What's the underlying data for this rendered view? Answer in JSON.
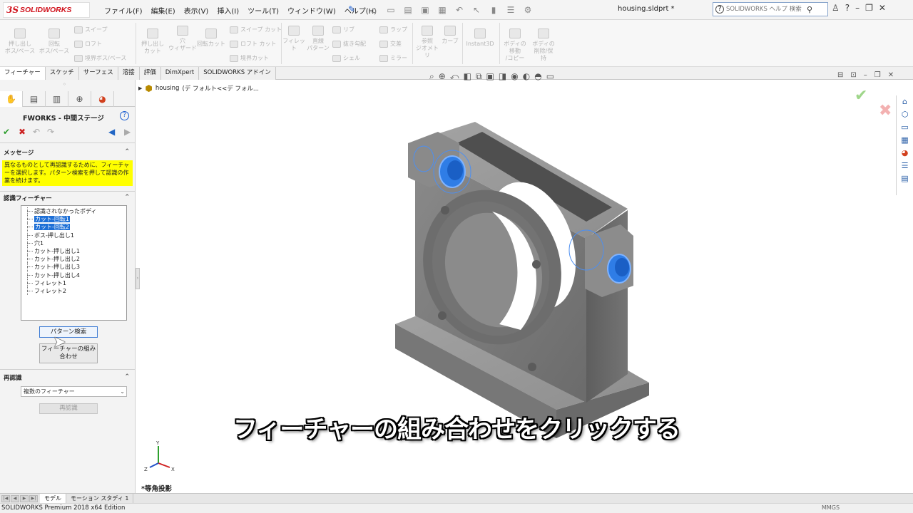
{
  "app": {
    "brand_mark": "3S",
    "brand_name": "SOLIDWORKS",
    "document_title": "housing.sldprt *",
    "help_search_placeholder": "SOLIDWORKS ヘルプ 検索"
  },
  "menu": [
    "ファイル(F)",
    "編集(E)",
    "表示(V)",
    "挿入(I)",
    "ツール(T)",
    "ウィンドウ(W)",
    "ヘルプ(H)"
  ],
  "command_manager": {
    "extrude_boss": "押し出し\nボス/ベース",
    "revolve_boss": "回転\nボス/ベース",
    "sweep": "スイープ",
    "loft": "ロフト",
    "boundary_boss": "境界ボス/ベース",
    "extrude_cut": "押し出し\nカット",
    "hole_wizard": "穴\nウィザード",
    "revolve_cut": "回転カット",
    "sweep_cut": "スイープ カット",
    "loft_cut": "ロフト カット",
    "boundary_cut": "境界カット",
    "fillet": "フィレット",
    "linear_pattern": "直線\nパターン",
    "rib": "リブ",
    "draft": "抜き勾配",
    "shell": "シェル",
    "wrap": "ラップ",
    "intersect": "交差",
    "mirror": "ミラー",
    "reference_geometry": "参照\nジオメトリ",
    "curves": "カーブ",
    "instant3d": "Instant3D",
    "move_copy_body": "ボディの\n移動\n/コピー",
    "delete_keep_body": "ボディの\n削除/保\n持"
  },
  "tabs": [
    "フィーチャー",
    "スケッチ",
    "サーフェス",
    "溶接",
    "評価",
    "DimXpert",
    "SOLIDWORKS アドイン"
  ],
  "property_manager": {
    "title": "FWORKS - 中間ステージ",
    "message_header": "メッセージ",
    "message_text": "異なるものとして再認識するために、フィーチャーを選択します。パターン検索を押して認識の作業を続けます。",
    "recognized_header": "認識フィーチャー",
    "features": [
      {
        "label": "認識されなかったボディ",
        "selected": false
      },
      {
        "label": "カット-回転1",
        "selected": true
      },
      {
        "label": "カット-回転2",
        "selected": true
      },
      {
        "label": "ボス-押し出し1",
        "selected": false
      },
      {
        "label": "穴1",
        "selected": false
      },
      {
        "label": "カット-押し出し1",
        "selected": false
      },
      {
        "label": "カット-押し出し2",
        "selected": false
      },
      {
        "label": "カット-押し出し3",
        "selected": false
      },
      {
        "label": "カット-押し出し4",
        "selected": false
      },
      {
        "label": "フィレット1",
        "selected": false
      },
      {
        "label": "フィレット2",
        "selected": false
      }
    ],
    "pattern_search_button": "パターン検索",
    "combine_features_button": "フィーチャーの組み合わせ",
    "rerecognize_header": "再認識",
    "rerecognize_select_value": "複数のフィーチャー",
    "rerecognize_button": "再認識"
  },
  "graphics": {
    "tree_root": "housing",
    "tree_suffix": "(デ フォルト<<デ フォル...",
    "view_label": "*等角投影",
    "subtitle": "フィーチャーの組み合わせをクリックする",
    "triad": {
      "x": "X",
      "y": "Y",
      "z": "Z"
    },
    "colors": {
      "body": "#7f7f7f",
      "highlight": "#1f6fe0",
      "accent": "#1d6fd6"
    }
  },
  "bottom_tabs": [
    "モデル",
    "モーション スタディ 1"
  ],
  "status": {
    "edition": "SOLIDWORKS Premium 2018 x64 Edition",
    "units": "MMGS"
  }
}
